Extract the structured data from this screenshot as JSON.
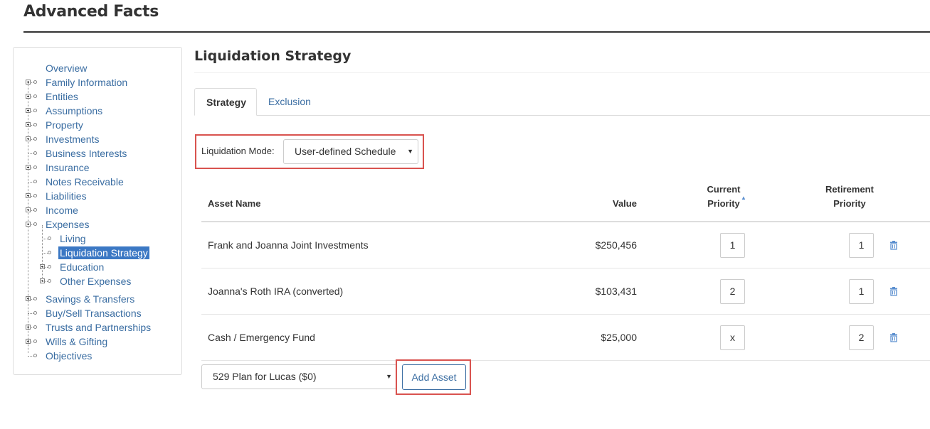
{
  "header": {
    "title": "Advanced Facts"
  },
  "sidebar": {
    "items": [
      {
        "label": "Overview",
        "depth": 0,
        "expander": "none",
        "connector": false
      },
      {
        "label": "Family Information",
        "depth": 0,
        "expander": "plus",
        "connector": true
      },
      {
        "label": "Entities",
        "depth": 0,
        "expander": "plus",
        "connector": true
      },
      {
        "label": "Assumptions",
        "depth": 0,
        "expander": "plus",
        "connector": true
      },
      {
        "label": "Property",
        "depth": 0,
        "expander": "plus",
        "connector": true
      },
      {
        "label": "Investments",
        "depth": 0,
        "expander": "plus",
        "connector": true
      },
      {
        "label": "Business Interests",
        "depth": 0,
        "expander": "none",
        "connector": true
      },
      {
        "label": "Insurance",
        "depth": 0,
        "expander": "plus",
        "connector": true
      },
      {
        "label": "Notes Receivable",
        "depth": 0,
        "expander": "none",
        "connector": true
      },
      {
        "label": "Liabilities",
        "depth": 0,
        "expander": "plus",
        "connector": true
      },
      {
        "label": "Income",
        "depth": 0,
        "expander": "plus",
        "connector": true
      },
      {
        "label": "Expenses",
        "depth": 0,
        "expander": "minus",
        "connector": true
      },
      {
        "label": "Living",
        "depth": 1,
        "expander": "none",
        "connector": true
      },
      {
        "label": "Liquidation Strategy",
        "depth": 1,
        "expander": "none",
        "connector": true,
        "selected": true
      },
      {
        "label": "Education",
        "depth": 1,
        "expander": "plus",
        "connector": true
      },
      {
        "label": "Other Expenses",
        "depth": 1,
        "expander": "plus",
        "connector": true
      },
      {
        "label": "Savings & Transfers",
        "depth": 0,
        "expander": "plus",
        "connector": true
      },
      {
        "label": "Buy/Sell Transactions",
        "depth": 0,
        "expander": "none",
        "connector": true
      },
      {
        "label": "Trusts and Partnerships",
        "depth": 0,
        "expander": "plus",
        "connector": true
      },
      {
        "label": "Wills & Gifting",
        "depth": 0,
        "expander": "plus",
        "connector": true
      },
      {
        "label": "Objectives",
        "depth": 0,
        "expander": "none",
        "connector": true
      }
    ]
  },
  "main": {
    "title": "Liquidation Strategy",
    "tabs": [
      {
        "label": "Strategy",
        "active": true
      },
      {
        "label": "Exclusion",
        "active": false
      }
    ],
    "liquidation_mode": {
      "label": "Liquidation Mode:",
      "selected": "User-defined Schedule",
      "arrow": "▼"
    },
    "table": {
      "columns": {
        "asset_name": "Asset Name",
        "value": "Value",
        "current_priority_line1": "Current",
        "current_priority_line2": "Priority",
        "retirement_priority_line1": "Retirement",
        "retirement_priority_line2": "Priority"
      },
      "sort_indicator": "▲",
      "rows": [
        {
          "asset": "Frank and Joanna Joint Investments",
          "value": "$250,456",
          "current": "1",
          "retirement": "1"
        },
        {
          "asset": "Joanna's Roth IRA (converted)",
          "value": "$103,431",
          "current": "2",
          "retirement": "1"
        },
        {
          "asset": "Cash / Emergency Fund",
          "value": "$25,000",
          "current": "x",
          "retirement": "2"
        }
      ]
    },
    "add_asset": {
      "selected": "529 Plan for Lucas ($0)",
      "arrow": "▼",
      "button_label": "Add Asset"
    }
  },
  "colors": {
    "link": "#3a6da2",
    "highlight": "#d9534f",
    "selected_bg": "#3b78c4"
  }
}
